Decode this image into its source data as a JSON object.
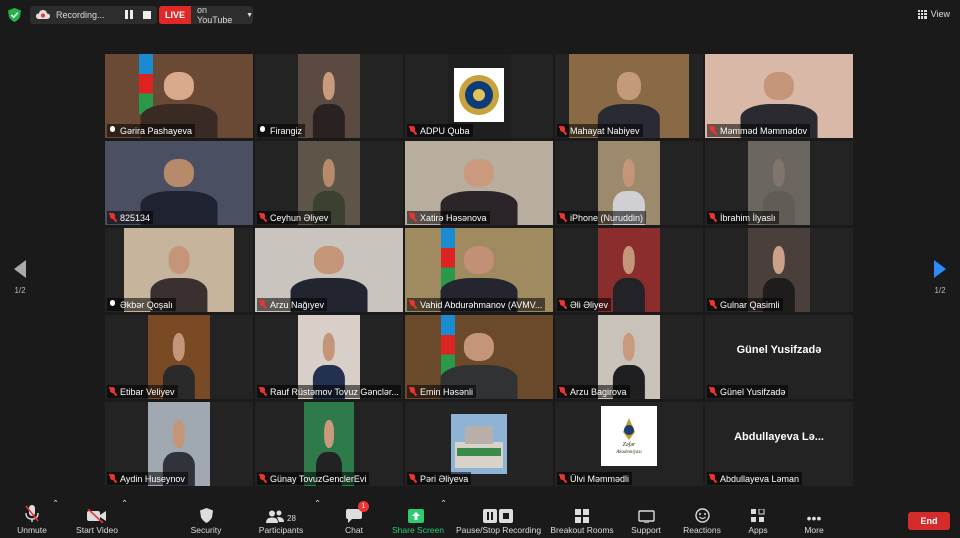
{
  "topbar": {
    "recording_label": "Recording...",
    "live_label": "LIVE",
    "stream_target": "on YouTube",
    "view_label": "View"
  },
  "pagination": {
    "left": "1/2",
    "right": "1/2"
  },
  "participants": [
    {
      "name": "Gərira Pashayeva",
      "muted": false,
      "active": true
    },
    {
      "name": "Firangiz",
      "muted": false
    },
    {
      "name": "ADPU Quba",
      "muted": true
    },
    {
      "name": "Mahayat Nabiyev",
      "muted": true
    },
    {
      "name": "Məmməd Məmmədov",
      "muted": true
    },
    {
      "name": "825134",
      "muted": true
    },
    {
      "name": "Ceyhun Əliyev",
      "muted": true
    },
    {
      "name": "Xatirə Həsənova",
      "muted": true
    },
    {
      "name": "iPhone (Nuruddin)",
      "muted": true
    },
    {
      "name": "İbrahim İlyaslı",
      "muted": true
    },
    {
      "name": "Əkbər Qoşalı",
      "muted": false
    },
    {
      "name": "Arzu Nağıyev",
      "muted": true
    },
    {
      "name": "Vahid Abdurəhmanov (AVMV...",
      "muted": true
    },
    {
      "name": "Əli Əliyev",
      "muted": true
    },
    {
      "name": "Gulnar Qasimli",
      "muted": true
    },
    {
      "name": "Etibar Veliyev",
      "muted": true
    },
    {
      "name": "Rauf Rüstəmov Tovuz Gənclər...",
      "muted": true
    },
    {
      "name": "Emin Həsənli",
      "muted": true
    },
    {
      "name": "Arzu Bagirova",
      "muted": true
    },
    {
      "name": "Günel Yusifzadə",
      "muted": true,
      "display_name": "Günel Yusifzadə"
    },
    {
      "name": "Aydin Huseynov",
      "muted": true
    },
    {
      "name": "Günay TovuzGenclerEvi",
      "muted": true
    },
    {
      "name": "Pəri Əliyeva",
      "muted": true
    },
    {
      "name": "Ülvi Məmmədli",
      "muted": true,
      "logo_text_1": "Zəfər",
      "logo_text_2": "Akademiyası"
    },
    {
      "name": "Abdullayeva Ləman",
      "muted": true,
      "display_name": "Abdullayeva Lə..."
    }
  ],
  "toolbar": {
    "unmute": "Unmute",
    "start_video": "Start Video",
    "security": "Security",
    "participants": "Participants",
    "participants_count": "28",
    "chat": "Chat",
    "chat_badge": "1",
    "share_screen": "Share Screen",
    "pause_recording": "Pause/Stop Recording",
    "breakout_rooms": "Breakout Rooms",
    "support": "Support",
    "reactions": "Reactions",
    "apps": "Apps",
    "more": "More",
    "end": "End"
  },
  "colors": {
    "active_outline": "#c7e36b",
    "live_red": "#e02828",
    "share_green": "#2ecc71",
    "end_red": "#d62b2b",
    "mic_off_red": "#e33333"
  }
}
